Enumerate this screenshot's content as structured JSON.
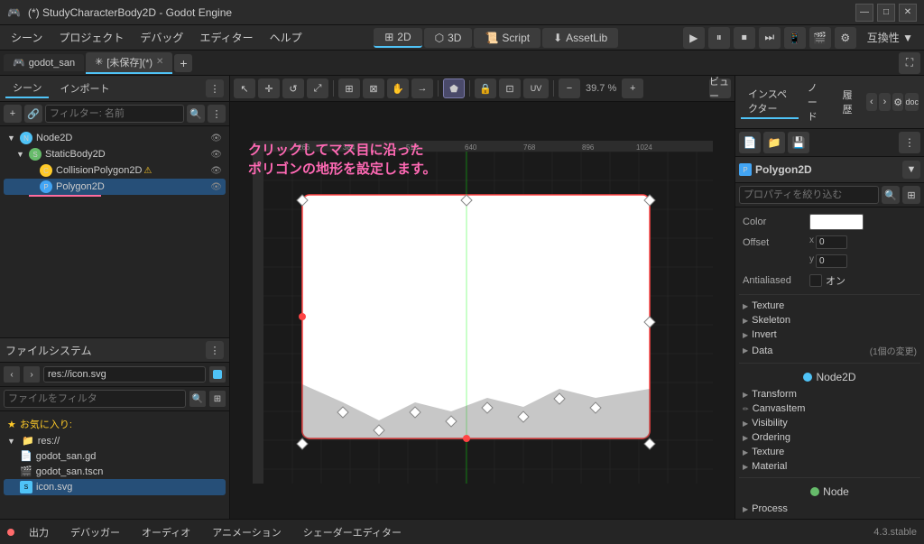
{
  "titlebar": {
    "title": "(*) StudyCharacterBody2D - Godot Engine",
    "min": "—",
    "max": "□",
    "close": "✕"
  },
  "menubar": {
    "items": [
      "シーン",
      "プロジェクト",
      "デバッグ",
      "エディター",
      "ヘルプ"
    ],
    "modes": [
      {
        "label": "2D",
        "icon": "⊞",
        "active": true
      },
      {
        "label": "3D",
        "icon": "⬡",
        "active": false
      },
      {
        "label": "Script",
        "icon": "📜",
        "active": false
      },
      {
        "label": "AssetLib",
        "icon": "⬇",
        "active": false
      }
    ],
    "compat": "互換性 ▼"
  },
  "tabs": [
    {
      "label": "🎮 godot_san",
      "active": false,
      "closable": false
    },
    {
      "label": "✳ [未保存](*)",
      "active": true,
      "closable": true
    }
  ],
  "scene_panel": {
    "tabs": [
      "シーン",
      "インポート"
    ],
    "filter_placeholder": "フィルター: 名前",
    "tree": [
      {
        "label": "Node2D",
        "icon": "N",
        "type": "node2d",
        "indent": 0,
        "expanded": true
      },
      {
        "label": "StaticBody2D",
        "icon": "S",
        "type": "static",
        "indent": 1,
        "expanded": true
      },
      {
        "label": "CollisionPolygon2D",
        "icon": "C",
        "type": "collision",
        "indent": 2,
        "warning": true
      },
      {
        "label": "Polygon2D",
        "icon": "P",
        "type": "polygon",
        "indent": 2,
        "selected": true
      }
    ]
  },
  "filesystem_panel": {
    "title": "ファイルシステム",
    "path": "res://icon.svg",
    "filter_placeholder": "ファイルをフィルタ",
    "favorites_label": "お気に入り:",
    "items": [
      {
        "label": "res://",
        "type": "folder",
        "expanded": true
      },
      {
        "label": "godot_san.gd",
        "type": "gd",
        "indent": 1
      },
      {
        "label": "godot_san.tscn",
        "type": "tscn",
        "indent": 1
      },
      {
        "label": "icon.svg",
        "type": "svg",
        "indent": 1,
        "selected": true
      }
    ]
  },
  "viewport": {
    "zoom": "39.7 %",
    "tools": [
      "✛",
      "↺",
      "⤢",
      "⊞",
      "⊠",
      "✋",
      "→",
      "⋮⋮",
      "⋯⋯",
      "🔒",
      "⊡",
      "⊿"
    ],
    "view_label": "ビュー"
  },
  "annotation": {
    "line1": "クリックしてマス目に沿った",
    "line2": "ポリゴンの地形を設定します。"
  },
  "inspector": {
    "tabs": [
      "インスペクター",
      "ノード",
      "履歴"
    ],
    "component": "Polygon2D",
    "filter_placeholder": "プロパティを絞り込む",
    "properties": [
      {
        "label": "Color",
        "type": "color",
        "value": "#ffffff"
      },
      {
        "label": "Offset",
        "type": "xy",
        "x": "0",
        "y": "0"
      },
      {
        "label": "Antialiased",
        "type": "checkbox",
        "value": false,
        "text": "オン"
      },
      {
        "label": "Texture",
        "type": "section"
      },
      {
        "label": "Skeleton",
        "type": "section"
      },
      {
        "label": "Invert",
        "type": "section"
      },
      {
        "label": "Data",
        "type": "section",
        "note": "(1個の変更)"
      }
    ],
    "node2d_label": "Node2D",
    "sections2": [
      "Transform",
      "CanvasItem",
      "Visibility",
      "Ordering",
      "Texture",
      "Material"
    ],
    "node_label": "Node",
    "sections3": [
      "Process"
    ]
  },
  "statusbar": {
    "items": [
      "出力",
      "デバッガー",
      "オーディオ",
      "アニメーション",
      "シェーダーエディター"
    ],
    "version": "4.3.stable"
  }
}
